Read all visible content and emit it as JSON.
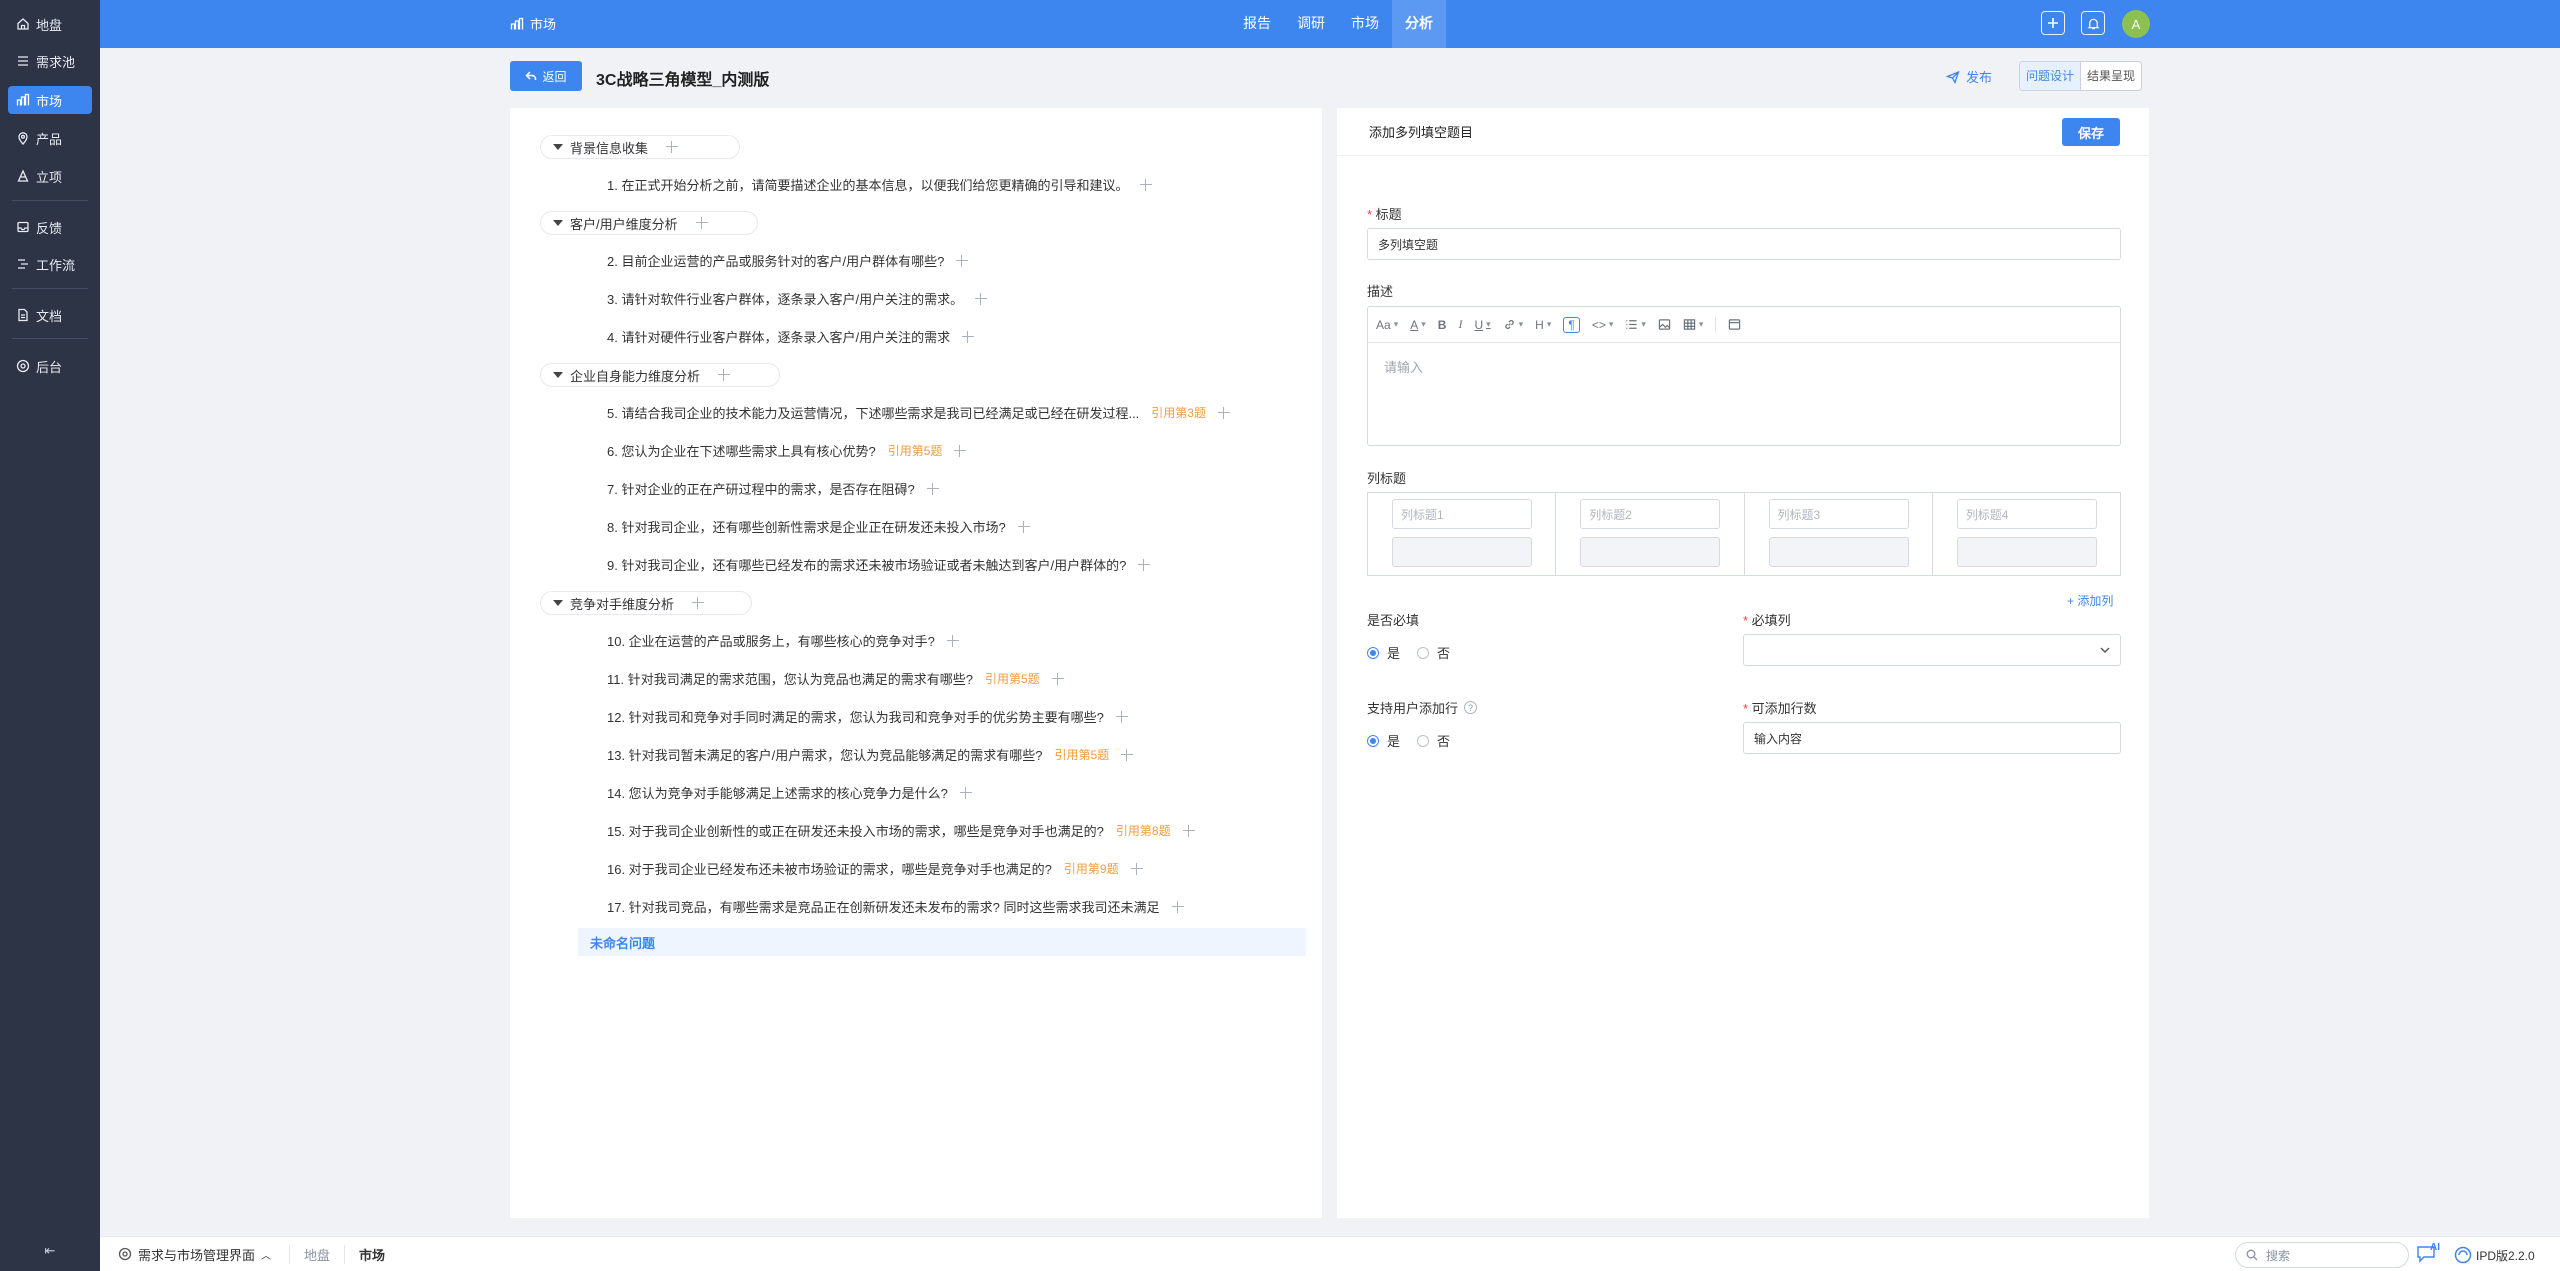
{
  "sidebar": {
    "items": [
      {
        "label": "地盘",
        "icon": "home-icon"
      },
      {
        "label": "需求池",
        "icon": "list-icon"
      },
      {
        "label": "市场",
        "icon": "chart-icon",
        "active": true
      },
      {
        "label": "产品",
        "icon": "pin-icon"
      },
      {
        "label": "立项",
        "icon": "user-icon"
      },
      {
        "label": "反馈",
        "icon": "inbox-icon"
      },
      {
        "label": "工作流",
        "icon": "flow-icon"
      },
      {
        "label": "文档",
        "icon": "document-icon"
      },
      {
        "label": "后台",
        "icon": "gear-icon"
      }
    ],
    "collapse_label": "⇤"
  },
  "topbar": {
    "section_label": "市场",
    "tabs": [
      "报告",
      "调研",
      "市场",
      "分析"
    ],
    "active_tab": "分析",
    "avatar_initial": "A"
  },
  "header": {
    "back_label": "返回",
    "title": "3C战略三角模型_内测版",
    "publish_label": "发布",
    "view_options": [
      "问题设计",
      "结果呈现"
    ],
    "active_view": "问题设计"
  },
  "outline": {
    "groups": [
      {
        "label": "背景信息收集",
        "questions": [
          {
            "text": "1. 在正式开始分析之前，请简要描述企业的基本信息，以便我们给您更精确的引导和建议。",
            "cite": ""
          }
        ]
      },
      {
        "label": "客户/用户维度分析",
        "questions": [
          {
            "text": "2. 目前企业运营的产品或服务针对的客户/用户群体有哪些?",
            "cite": ""
          },
          {
            "text": "3. 请针对软件行业客户群体，逐条录入客户/用户关注的需求。",
            "cite": ""
          },
          {
            "text": "4. 请针对硬件行业客户群体，逐条录入客户/用户关注的需求",
            "cite": ""
          }
        ]
      },
      {
        "label": "企业自身能力维度分析",
        "questions": [
          {
            "text": "5. 请结合我司企业的技术能力及运营情况，下述哪些需求是我司已经满足或已经在研发过程...",
            "cite": "引用第3题"
          },
          {
            "text": "6. 您认为企业在下述哪些需求上具有核心优势?",
            "cite": "引用第5题"
          },
          {
            "text": "7. 针对企业的正在产研过程中的需求，是否存在阻碍?",
            "cite": ""
          },
          {
            "text": "8. 针对我司企业，还有哪些创新性需求是企业正在研发还未投入市场?",
            "cite": ""
          },
          {
            "text": "9. 针对我司企业，还有哪些已经发布的需求还未被市场验证或者未触达到客户/用户群体的?",
            "cite": ""
          }
        ]
      },
      {
        "label": "竞争对手维度分析",
        "questions": [
          {
            "text": "10. 企业在运营的产品或服务上，有哪些核心的竞争对手?",
            "cite": ""
          },
          {
            "text": "11. 针对我司满足的需求范围，您认为竞品也满足的需求有哪些?",
            "cite": "引用第5题"
          },
          {
            "text": "12. 针对我司和竞争对手同时满足的需求，您认为我司和竞争对手的优劣势主要有哪些?",
            "cite": ""
          },
          {
            "text": "13. 针对我司暂未满足的客户/用户需求，您认为竞品能够满足的需求有哪些?",
            "cite": "引用第5题"
          },
          {
            "text": "14. 您认为竞争对手能够满足上述需求的核心竞争力是什么?",
            "cite": ""
          },
          {
            "text": "15. 对于我司企业创新性的或正在研发还未投入市场的需求，哪些是竞争对手也满足的?",
            "cite": "引用第8题"
          },
          {
            "text": "16. 对于我司企业已经发布还未被市场验证的需求，哪些是竞争对手也满足的?",
            "cite": "引用第9题"
          },
          {
            "text": "17. 针对我司竞品，有哪些需求是竞品正在创新研发还未发布的需求? 同时这些需求我司还未满足",
            "cite": ""
          }
        ]
      }
    ],
    "unnamed_label": "未命名问题"
  },
  "form": {
    "panel_title": "添加多列填空题目",
    "save_label": "保存",
    "title_label": "标题",
    "title_value": "多列填空题",
    "desc_label": "描述",
    "desc_placeholder": "请输入",
    "toolbar": [
      "Aa",
      "A",
      "B",
      "I",
      "U",
      "link",
      "H",
      "¶",
      "<>",
      "list",
      "image",
      "table",
      "block"
    ],
    "col_label": "列标题",
    "col_placeholders": [
      "列标题1",
      "列标题2",
      "列标题3",
      "列标题4"
    ],
    "add_col_label": "添加列",
    "required_label": "是否必填",
    "required_col_label": "必填列",
    "yes_label": "是",
    "no_label": "否",
    "add_row_label": "支持用户添加行",
    "row_count_label": "可添加行数",
    "row_count_placeholder": "输入内容"
  },
  "bottombar": {
    "system_label": "需求与市场管理界面",
    "crumbs": [
      "地盘",
      "市场"
    ],
    "search_placeholder": "搜索",
    "ai_label": "AI",
    "version_label": "IPD版2.2.0"
  },
  "colors": {
    "primary": "#3d86f0",
    "sidebar": "#2d3445",
    "cite": "#f39c3c",
    "required": "#e5484d"
  }
}
